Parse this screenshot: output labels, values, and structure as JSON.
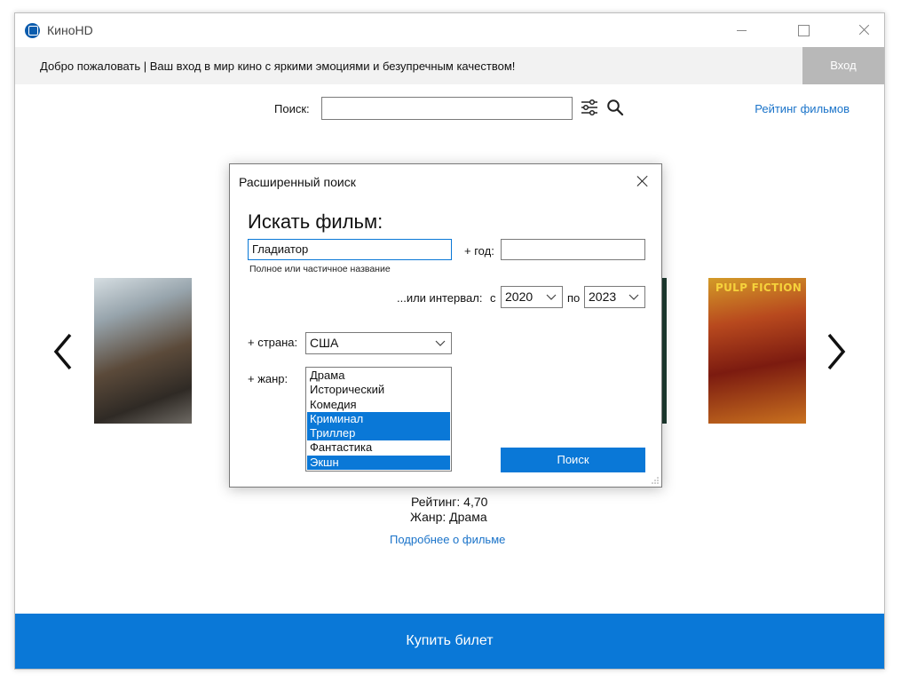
{
  "window": {
    "title": "КиноHD",
    "controls": [
      "minimize",
      "maximize",
      "close"
    ]
  },
  "banner": {
    "welcome_text": "Добро пожаловать | Ваш вход в мир кино с яркими эмоциями и безупречным качеством!",
    "login_label": "Вход"
  },
  "search": {
    "label": "Поиск:",
    "value": "",
    "filter_icon": "sliders-icon",
    "search_icon": "magnifier-icon"
  },
  "rating_link": "Рейтинг фильмов",
  "carousel": {
    "prev_icon": "chevron-left-icon",
    "next_icon": "chevron-right-icon",
    "left_poster": "gladiator-poster",
    "right_poster": "pulp-fiction-poster",
    "right_poster_text": "PULP FICTION"
  },
  "movie": {
    "rating": "Рейтинг: 4,70",
    "genre": "Жанр: Драма",
    "details_link": "Подробнее о фильме"
  },
  "buy_button": "Купить билет",
  "dialog": {
    "title": "Расширенный поиск",
    "heading": "Искать фильм:",
    "title_value": "Гладиатор",
    "title_hint": "Полное или частичное название",
    "year_label": "+ год:",
    "year_value": "",
    "interval_label": "...или интервал:",
    "from_label": "с",
    "from_value": "2020",
    "to_label": "по",
    "to_value": "2023",
    "country_label": "+ страна:",
    "country_value": "США",
    "genre_label": "+ жанр:",
    "genres": [
      {
        "label": "Драма",
        "selected": false
      },
      {
        "label": "Исторический",
        "selected": false
      },
      {
        "label": "Комедия",
        "selected": false
      },
      {
        "label": "Криминал",
        "selected": true
      },
      {
        "label": "Триллер",
        "selected": true
      },
      {
        "label": "Фантастика",
        "selected": false
      },
      {
        "label": "Экшн",
        "selected": true
      }
    ],
    "search_button": "Поиск"
  },
  "colors": {
    "accent": "#0a78d7",
    "link": "#1a73c9",
    "banner_bg": "#f2f2f2",
    "login_bg": "#b8b8b8"
  }
}
